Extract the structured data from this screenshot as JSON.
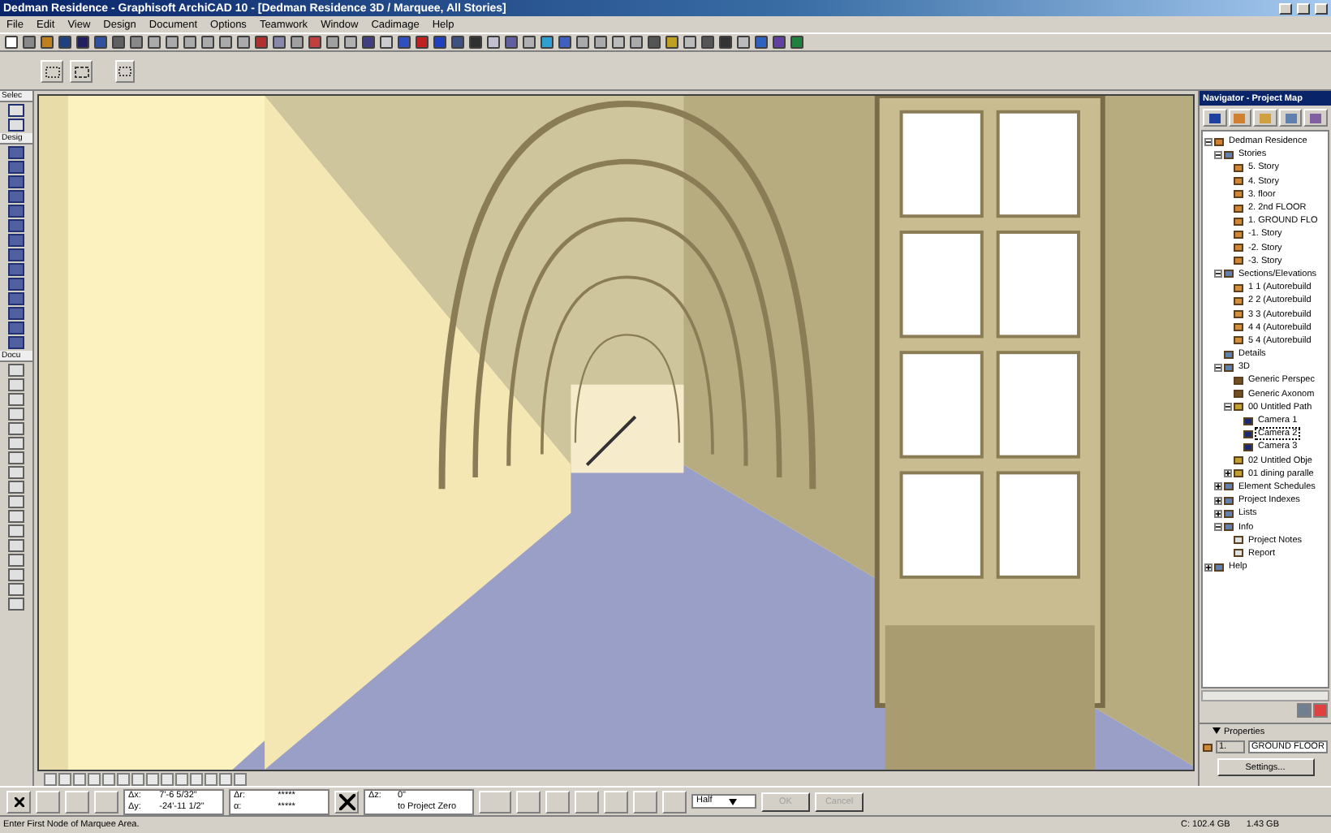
{
  "window": {
    "title": "Dedman Residence - Graphisoft ArchiCAD 10 - [Dedman Residence 3D / Marquee, All Stories]"
  },
  "menu": [
    "File",
    "Edit",
    "View",
    "Design",
    "Document",
    "Options",
    "Teamwork",
    "Window",
    "Cadimage",
    "Help"
  ],
  "toolbox": {
    "sections": [
      {
        "title": "Selec"
      },
      {
        "title": "Desig"
      },
      {
        "title": "Docu"
      }
    ]
  },
  "navigator": {
    "title": "Navigator - Project Map",
    "tree": [
      {
        "label": "Dedman Residence",
        "kind": "project",
        "expanded": true,
        "selected": false,
        "children": [
          {
            "label": "Stories",
            "kind": "group",
            "expanded": true,
            "selected": false,
            "children": [
              {
                "label": "5. Story",
                "kind": "story",
                "selected": false
              },
              {
                "label": "4. Story",
                "kind": "story",
                "selected": false
              },
              {
                "label": "3. floor",
                "kind": "story",
                "selected": false
              },
              {
                "label": "2. 2nd FLOOR",
                "kind": "story",
                "selected": false
              },
              {
                "label": "1. GROUND FLO",
                "kind": "story",
                "selected": false
              },
              {
                "label": "-1. Story",
                "kind": "story",
                "selected": false
              },
              {
                "label": "-2. Story",
                "kind": "story",
                "selected": false
              },
              {
                "label": "-3. Story",
                "kind": "story",
                "selected": false
              }
            ]
          },
          {
            "label": "Sections/Elevations",
            "kind": "group",
            "expanded": true,
            "selected": false,
            "children": [
              {
                "label": "1 1 (Autorebuild",
                "kind": "section",
                "selected": false
              },
              {
                "label": "2 2 (Autorebuild",
                "kind": "section",
                "selected": false
              },
              {
                "label": "3 3 (Autorebuild",
                "kind": "section",
                "selected": false
              },
              {
                "label": "4 4 (Autorebuild",
                "kind": "section",
                "selected": false
              },
              {
                "label": "5 4 (Autorebuild",
                "kind": "section",
                "selected": false
              }
            ]
          },
          {
            "label": "Details",
            "kind": "group",
            "selected": false
          },
          {
            "label": "3D",
            "kind": "group",
            "expanded": true,
            "selected": false,
            "children": [
              {
                "label": "Generic Perspec",
                "kind": "view",
                "selected": false
              },
              {
                "label": "Generic Axonom",
                "kind": "view",
                "selected": false
              },
              {
                "label": "00 Untitled Path",
                "kind": "path",
                "expanded": true,
                "selected": false,
                "children": [
                  {
                    "label": "Camera 1",
                    "kind": "camera",
                    "selected": false
                  },
                  {
                    "label": "Camera 2",
                    "kind": "camera",
                    "selected": true
                  },
                  {
                    "label": "Camera 3",
                    "kind": "camera",
                    "selected": false
                  }
                ]
              },
              {
                "label": "02 Untitled Obje",
                "kind": "path",
                "selected": false
              },
              {
                "label": "01 dining paralle",
                "kind": "path",
                "expanded": false,
                "selected": false
              }
            ]
          },
          {
            "label": "Element Schedules",
            "kind": "group",
            "expanded": false,
            "selected": false
          },
          {
            "label": "Project Indexes",
            "kind": "group",
            "expanded": false,
            "selected": false
          },
          {
            "label": "Lists",
            "kind": "group",
            "expanded": false,
            "selected": false
          },
          {
            "label": "Info",
            "kind": "group",
            "expanded": true,
            "selected": false,
            "children": [
              {
                "label": "Project Notes",
                "kind": "note",
                "selected": false
              },
              {
                "label": "Report",
                "kind": "note",
                "selected": false
              }
            ]
          }
        ]
      },
      {
        "label": "Help",
        "kind": "group",
        "expanded": false,
        "selected": false
      }
    ]
  },
  "properties": {
    "title": "Properties",
    "number": "1.",
    "name": "GROUND FLOOR",
    "button": "Settings..."
  },
  "info_box": {
    "dx_label": "Δx:",
    "dx": "7'-6 5/32\"",
    "dy_label": "Δy:",
    "dy": "-24'-11 1/2\"",
    "dr_label": "Δr:",
    "dr": "*****",
    "a_label": "α:",
    "a": "*****",
    "dz_label": "Δz:",
    "dz": "0\"",
    "reference": "to Project Zero",
    "mode": "Half",
    "ok": "OK",
    "cancel": "Cancel",
    "buttons_disabled": true
  },
  "status_bar": {
    "message": "Enter First Node of Marquee Area.",
    "disk": "C: 102.4 GB",
    "memory": "1.43 GB"
  }
}
